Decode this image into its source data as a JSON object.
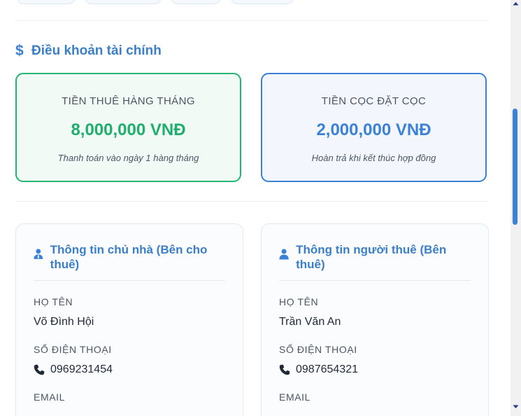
{
  "finance": {
    "title": "Điều khoản tài chính",
    "monthly_rent": {
      "label": "TIỀN THUÊ HÀNG THÁNG",
      "amount": "8,000,000 VNĐ",
      "note": "Thanh toán vào ngày 1 hàng tháng",
      "color": "#1fae6b"
    },
    "deposit": {
      "label": "TIỀN CỌC ĐẶT CỌC",
      "amount": "2,000,000 VNĐ",
      "note": "Hoàn trả khi kết thúc hợp đồng",
      "color": "#3b82d6"
    }
  },
  "landlord": {
    "title": "Thông tin chủ nhà (Bên cho thuê)",
    "name_label": "HỌ TÊN",
    "name": "Võ Đình Hội",
    "phone_label": "SỐ ĐIỆN THOẠI",
    "phone": "0969231454",
    "email_label": "EMAIL"
  },
  "tenant": {
    "title": "Thông tin người thuê (Bên thuê)",
    "name_label": "HỌ TÊN",
    "name": "Trần Văn An",
    "phone_label": "SỐ ĐIỆN THOẠI",
    "phone": "0987654321",
    "email_label": "EMAIL"
  },
  "theme": {
    "accent": "#3b82d6",
    "success": "#1fae6b"
  },
  "icons": {
    "finance": "dollar-icon",
    "landlord": "user-tie-icon",
    "tenant": "user-icon",
    "phone": "phone-icon"
  }
}
